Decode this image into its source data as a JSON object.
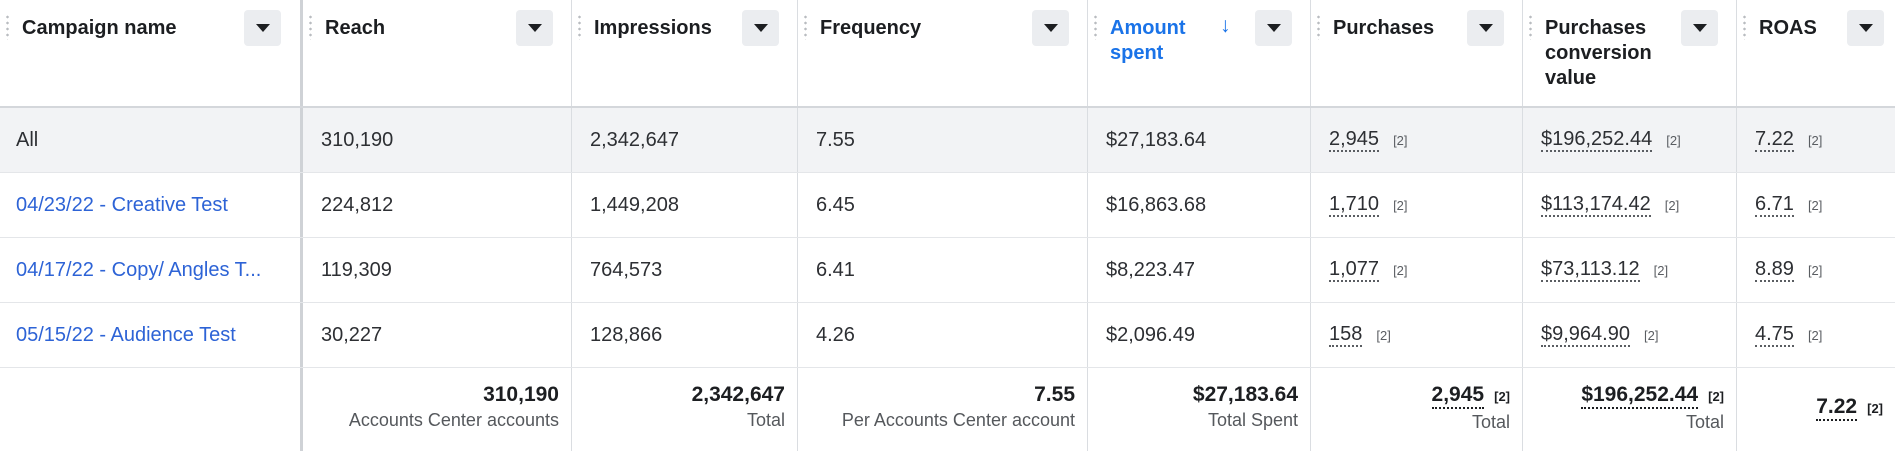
{
  "columns": [
    {
      "label": "Campaign name"
    },
    {
      "label": "Reach"
    },
    {
      "label": "Impressions"
    },
    {
      "label": "Frequency"
    },
    {
      "label": "Amount spent"
    },
    {
      "label": "Purchases"
    },
    {
      "label": "Purchases conversion value"
    },
    {
      "label": "ROAS"
    }
  ],
  "sort_indicator": "↓",
  "rows": [
    {
      "name": "All",
      "reach": "310,190",
      "impressions": "2,342,647",
      "frequency": "7.55",
      "amount_spent": "$27,183.64",
      "purchases": "2,945",
      "purchases_badge": "[2]",
      "conversion_value": "$196,252.44",
      "conversion_badge": "[2]",
      "roas": "7.22",
      "roas_badge": "[2]"
    },
    {
      "name": "04/23/22 - Creative Test",
      "reach": "224,812",
      "impressions": "1,449,208",
      "frequency": "6.45",
      "amount_spent": "$16,863.68",
      "purchases": "1,710",
      "purchases_badge": "[2]",
      "conversion_value": "$113,174.42",
      "conversion_badge": "[2]",
      "roas": "6.71",
      "roas_badge": "[2]"
    },
    {
      "name": "04/17/22 - Copy/ Angles T...",
      "reach": "119,309",
      "impressions": "764,573",
      "frequency": "6.41",
      "amount_spent": "$8,223.47",
      "purchases": "1,077",
      "purchases_badge": "[2]",
      "conversion_value": "$73,113.12",
      "conversion_badge": "[2]",
      "roas": "8.89",
      "roas_badge": "[2]"
    },
    {
      "name": "05/15/22 - Audience Test",
      "reach": "30,227",
      "impressions": "128,866",
      "frequency": "4.26",
      "amount_spent": "$2,096.49",
      "purchases": "158",
      "purchases_badge": "[2]",
      "conversion_value": "$9,964.90",
      "conversion_badge": "[2]",
      "roas": "4.75",
      "roas_badge": "[2]"
    }
  ],
  "totals": {
    "reach": {
      "value": "310,190",
      "label": "Accounts Center accounts"
    },
    "impressions": {
      "value": "2,342,647",
      "label": "Total"
    },
    "frequency": {
      "value": "7.55",
      "label": "Per Accounts Center account"
    },
    "amount_spent": {
      "value": "$27,183.64",
      "label": "Total Spent"
    },
    "purchases": {
      "value": "2,945",
      "badge": "[2]",
      "label": "Total"
    },
    "conversion_value": {
      "value": "$196,252.44",
      "badge": "[2]",
      "label": "Total"
    },
    "roas": {
      "value": "7.22",
      "badge": "[2]"
    }
  },
  "colors": {
    "link": "#2d63d6",
    "sorted_header": "#1a73e8",
    "all_row_bg": "#f2f3f5"
  }
}
